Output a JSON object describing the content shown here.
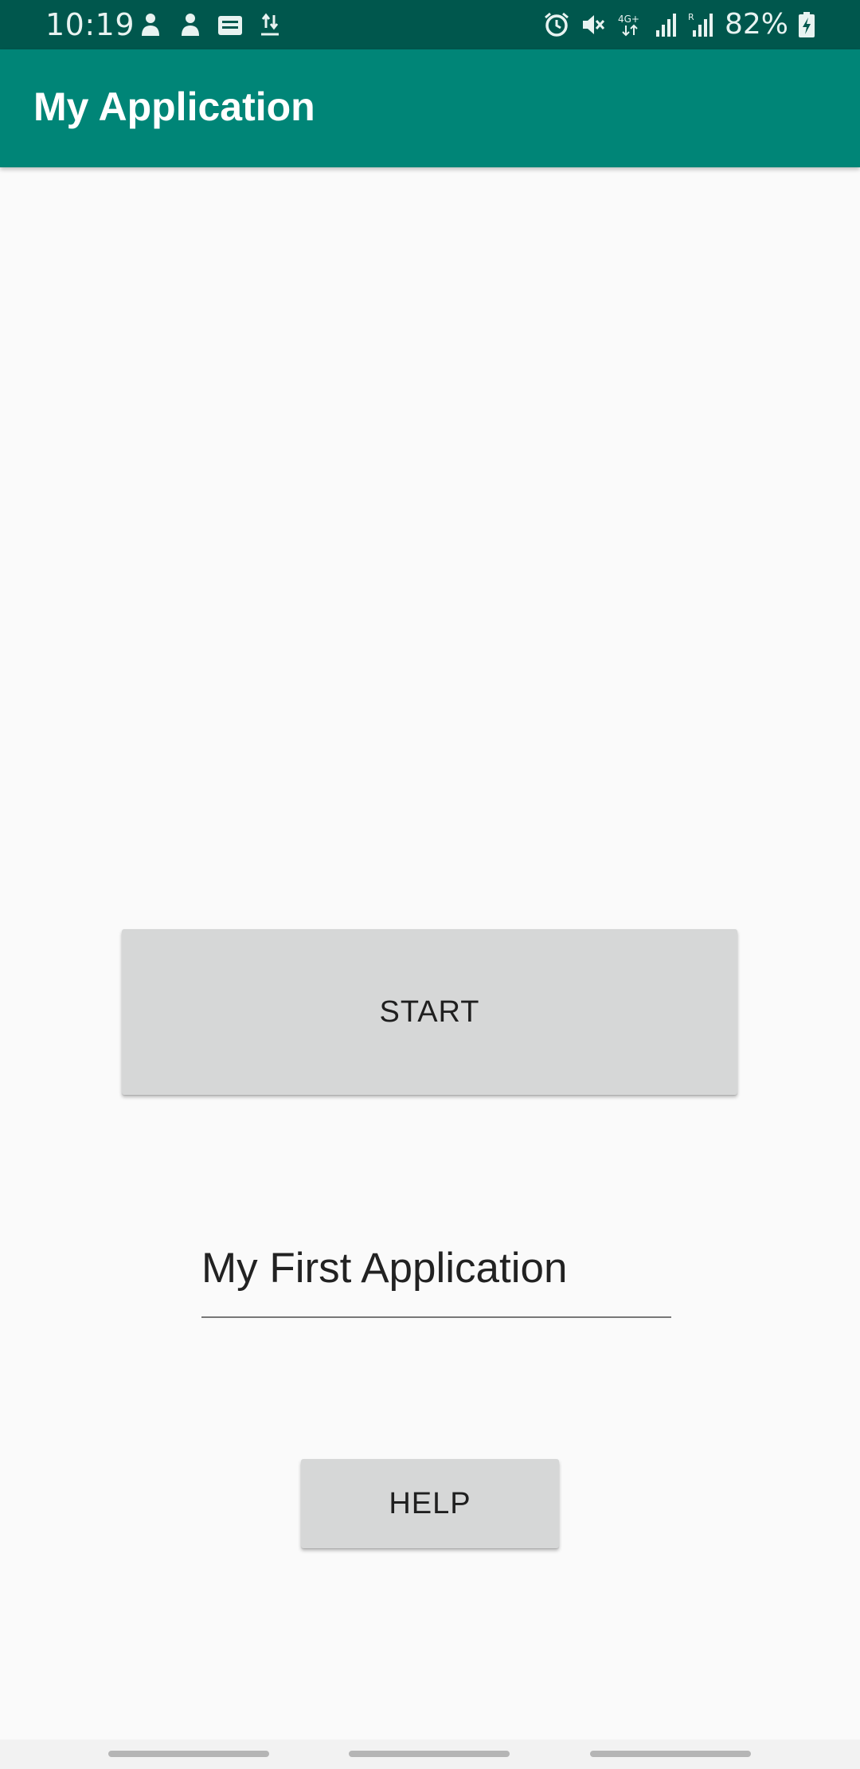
{
  "status_bar": {
    "time": "10:19",
    "network": "4G+",
    "battery": "82%",
    "left_icons": [
      "app-notification-icon",
      "app-notification-icon",
      "webtoon-icon",
      "transfer-icon"
    ],
    "right_icons": [
      "alarm-icon",
      "mute-icon",
      "network-4g-icon",
      "signal-icon",
      "roaming-signal-icon",
      "battery-charging-icon"
    ]
  },
  "app_bar": {
    "title": "My Application",
    "color": "#008577",
    "status_color": "#00574d"
  },
  "main": {
    "start_button_label": "START",
    "text_field_value": "My First Application",
    "help_button_label": "HELP"
  },
  "nav_bar": {
    "handles": [
      "nav-handle",
      "nav-handle",
      "nav-handle"
    ]
  }
}
